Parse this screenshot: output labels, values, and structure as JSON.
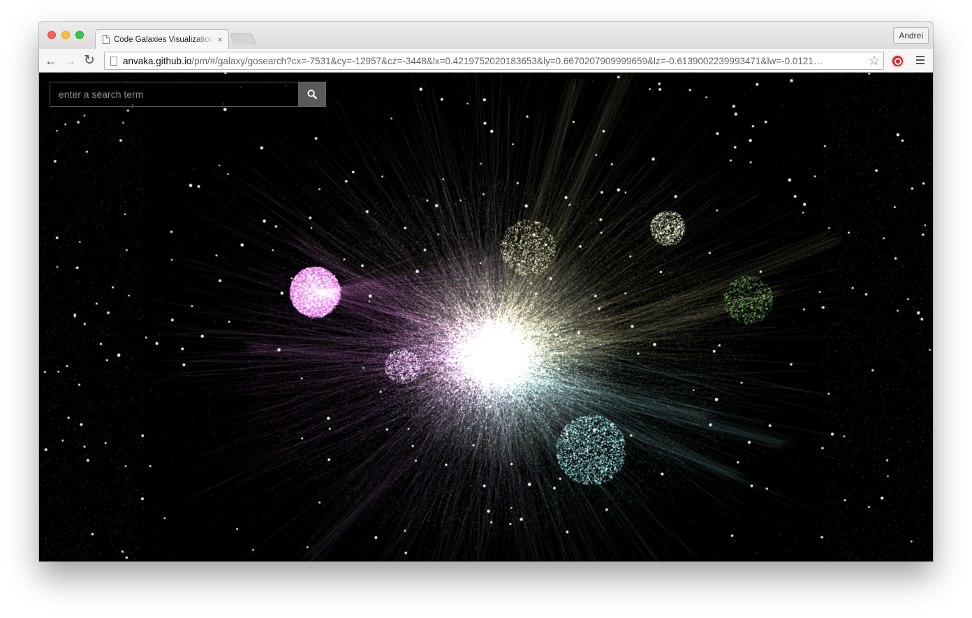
{
  "browser": {
    "tab_title": "Code Galaxies Visualization",
    "tab_close": "×",
    "profile_name": "Andrei",
    "url_host": "anvaka.github.io",
    "url_rest": "/pm/#/galaxy/gosearch?cx=-7531&cy=-12957&cz=-3448&lx=0.4219752020183653&ly=0.6670207909999659&lz=-0.6139002239993471&lw=-0.0121…",
    "back_glyph": "←",
    "forward_glyph": "→",
    "reload_glyph": "↻",
    "star_glyph": "☆"
  },
  "search": {
    "placeholder": "enter a search term",
    "value": "",
    "icon": "search-icon"
  },
  "icons": {
    "extension": "stop-extension-icon",
    "menu": "hamburger-menu-icon",
    "page": "page-icon"
  },
  "colors": {
    "background": "#000000",
    "magenta_cluster": "#e676e6",
    "yellow_cluster": "#e8d878",
    "green_cluster": "#6fdc6f",
    "cyan_cluster": "#8ff0f0",
    "core": "#ffffff"
  }
}
